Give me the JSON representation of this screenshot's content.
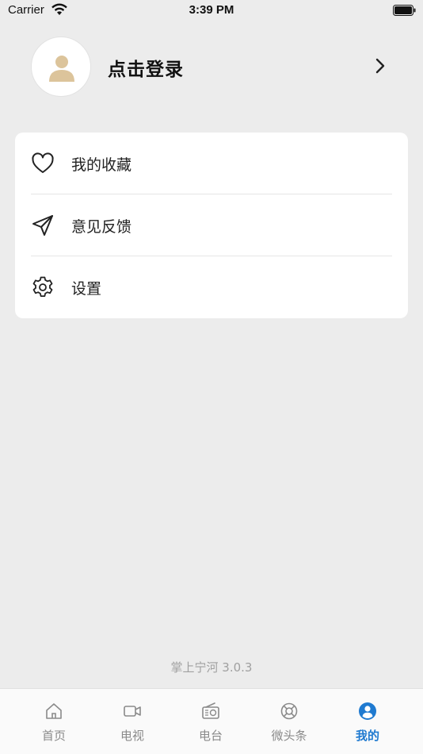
{
  "status_bar": {
    "carrier": "Carrier",
    "time": "3:39 PM"
  },
  "profile": {
    "login_label": "点击登录",
    "avatar_icon": "user-icon",
    "chevron_icon": "chevron-right-icon"
  },
  "menu": {
    "items": [
      {
        "label": "我的收藏",
        "icon": "heart-icon"
      },
      {
        "label": "意见反馈",
        "icon": "send-icon"
      },
      {
        "label": "设置",
        "icon": "gear-icon"
      }
    ]
  },
  "footer": {
    "version": "掌上宁河 3.0.3"
  },
  "tabs": [
    {
      "label": "首页",
      "icon": "home-icon",
      "active": false
    },
    {
      "label": "电视",
      "icon": "video-camera-icon",
      "active": false
    },
    {
      "label": "电台",
      "icon": "radio-icon",
      "active": false
    },
    {
      "label": "微头条",
      "icon": "lifebuoy-icon",
      "active": false
    },
    {
      "label": "我的",
      "icon": "user-circle-icon",
      "active": true
    }
  ],
  "colors": {
    "background": "#ececec",
    "accent": "#1f7ad0",
    "avatar_fill": "#dcc49b",
    "tab_inactive": "#8a8a8a"
  }
}
